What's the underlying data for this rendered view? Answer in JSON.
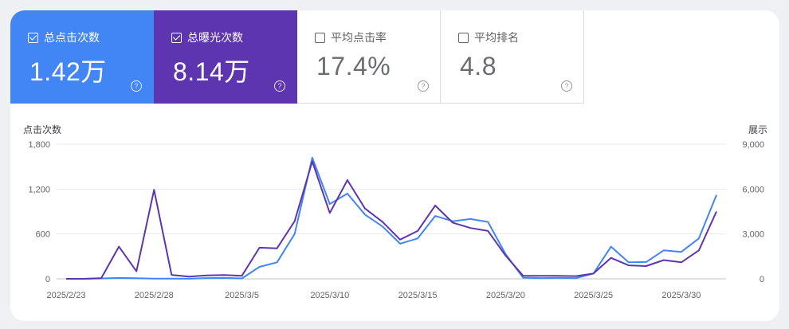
{
  "metrics": [
    {
      "label": "总点击次数",
      "value": "1.42万",
      "checked": true,
      "color": "#4285f4"
    },
    {
      "label": "总曝光次数",
      "value": "8.14万",
      "checked": true,
      "color": "#5e35b1"
    },
    {
      "label": "平均点击率",
      "value": "17.4%",
      "checked": false,
      "color": "#ffffff"
    },
    {
      "label": "平均排名",
      "value": "4.8",
      "checked": false,
      "color": "#ffffff"
    }
  ],
  "help_glyph": "?",
  "chart_data": {
    "type": "line",
    "y_left_label": "点击次数",
    "y_right_label": "展示",
    "y_left_ticks": [
      "1,800",
      "1,200",
      "600",
      "0"
    ],
    "y_right_ticks": [
      "9,000",
      "6,000",
      "3,000",
      "0"
    ],
    "y_left_lim": [
      0,
      1800
    ],
    "y_right_lim": [
      0,
      9000
    ],
    "x_tick_labels": [
      "2025/2/23",
      "2025/2/28",
      "2025/3/5",
      "2025/3/10",
      "2025/3/15",
      "2025/3/20",
      "2025/3/25",
      "2025/3/30"
    ],
    "x_dates": [
      "2025/2/23",
      "2025/2/24",
      "2025/2/25",
      "2025/2/26",
      "2025/2/27",
      "2025/2/28",
      "2025/3/1",
      "2025/3/2",
      "2025/3/3",
      "2025/3/4",
      "2025/3/5",
      "2025/3/6",
      "2025/3/7",
      "2025/3/8",
      "2025/3/9",
      "2025/3/10",
      "2025/3/11",
      "2025/3/12",
      "2025/3/13",
      "2025/3/14",
      "2025/3/15",
      "2025/3/16",
      "2025/3/17",
      "2025/3/18",
      "2025/3/19",
      "2025/3/20",
      "2025/3/21",
      "2025/3/22",
      "2025/3/23",
      "2025/3/24",
      "2025/3/25",
      "2025/3/26",
      "2025/3/27",
      "2025/3/28",
      "2025/3/29",
      "2025/3/30",
      "2025/3/31",
      "2025/4/1"
    ],
    "series": [
      {
        "name": "总点击次数",
        "axis": "left",
        "color": "#4285f4",
        "values": [
          0,
          0,
          5,
          12,
          8,
          2,
          2,
          1,
          10,
          12,
          5,
          160,
          220,
          600,
          1620,
          1000,
          1140,
          860,
          700,
          470,
          540,
          840,
          770,
          800,
          760,
          330,
          15,
          10,
          12,
          10,
          70,
          430,
          220,
          225,
          380,
          360,
          540,
          1120
        ]
      },
      {
        "name": "总曝光次数",
        "axis": "right",
        "color": "#5e35b1",
        "values": [
          0,
          0,
          50,
          2150,
          500,
          5950,
          260,
          150,
          230,
          250,
          200,
          2080,
          2040,
          3850,
          7850,
          4400,
          6600,
          4700,
          3800,
          2620,
          3200,
          4900,
          3750,
          3400,
          3200,
          1550,
          200,
          200,
          200,
          180,
          350,
          1400,
          900,
          850,
          1250,
          1100,
          1900,
          4500
        ]
      }
    ]
  }
}
